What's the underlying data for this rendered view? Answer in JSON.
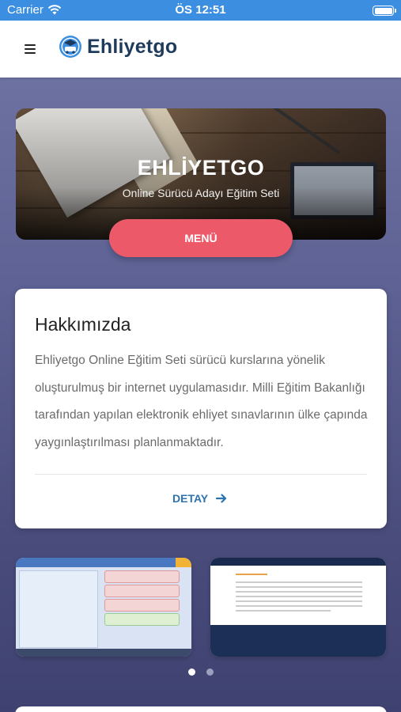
{
  "status_bar": {
    "carrier": "Carrier",
    "time": "ÖS 12:51"
  },
  "header": {
    "logo_text": "Ehliyetgo"
  },
  "hero": {
    "title": "EHLİYETGO",
    "subtitle": "Online Sürücü Adayı Eğitim Seti",
    "menu_label": "MENÜ"
  },
  "about": {
    "title": "Hakkımızda",
    "text": "Ehliyetgo Online Eğitim Seti sürücü kurslarına yönelik oluşturulmuş bir internet uygulamasıdır. Milli Eğitim Bakanlığı tarafından yapılan elektronik ehliyet sınavlarının ülke çapında yaygınlaştırılması planlanmaktadır.",
    "detail_label": "DETAY"
  },
  "carousel": {
    "page_count": 2,
    "active_index": 0
  },
  "colors": {
    "accent": "#ec5a6a",
    "status_bar": "#3b8ee0",
    "link": "#2d73b0",
    "brand": "#1f3b5c"
  }
}
